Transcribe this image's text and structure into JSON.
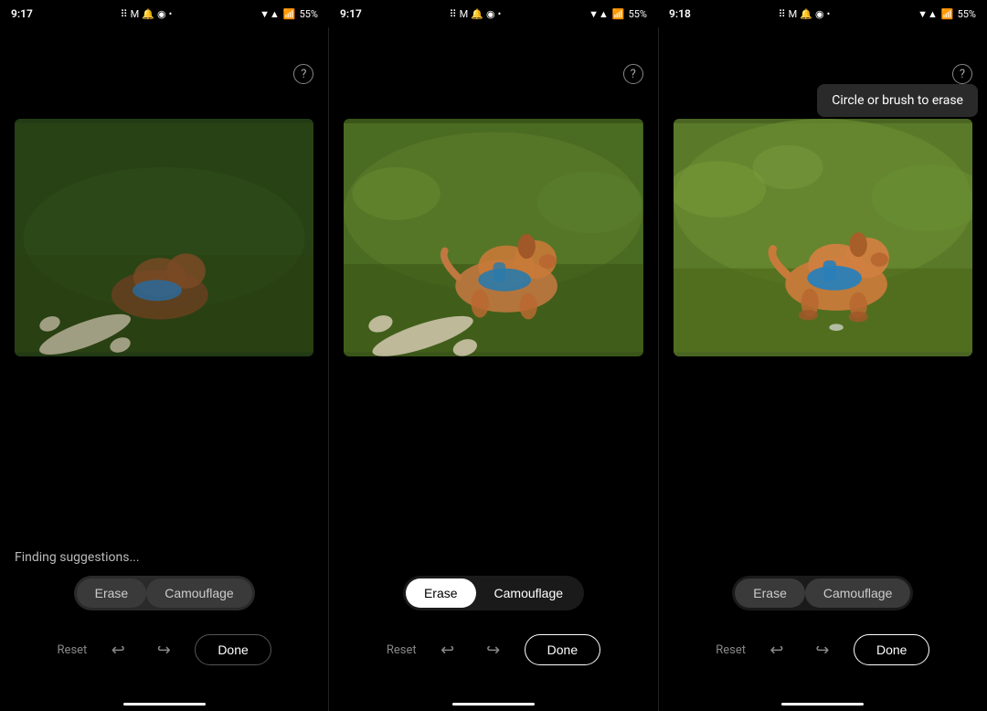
{
  "statusBars": [
    {
      "time": "9:17",
      "battery": "55%",
      "icons": "▼▲ 55%"
    },
    {
      "time": "9:17",
      "battery": "55%"
    },
    {
      "time": "9:18",
      "battery": "55%"
    }
  ],
  "panels": [
    {
      "id": "panel1",
      "showHelp": true,
      "showTooltip": false,
      "findingText": "Finding suggestions...",
      "erase": {
        "eraseLabel": "Erase",
        "eraseActive": false,
        "camouflageLabel": "Camouflage",
        "camouflageActive": false
      },
      "toolbar": {
        "resetLabel": "Reset",
        "doneLabel": "Done",
        "doneActive": false
      }
    },
    {
      "id": "panel2",
      "showHelp": true,
      "showTooltip": false,
      "erase": {
        "eraseLabel": "Erase",
        "eraseActive": true,
        "camouflageLabel": "Camouflage",
        "camouflageActive": false
      },
      "toolbar": {
        "resetLabel": "Reset",
        "doneLabel": "Done",
        "doneActive": true
      }
    },
    {
      "id": "panel3",
      "showHelp": true,
      "showTooltip": true,
      "tooltipText": "Circle or brush to erase",
      "erase": {
        "eraseLabel": "Erase",
        "eraseActive": false,
        "camouflageLabel": "Camouflage",
        "camouflageActive": false
      },
      "toolbar": {
        "resetLabel": "Reset",
        "doneLabel": "Done",
        "doneActive": true
      }
    }
  ],
  "icons": {
    "undo": "↩",
    "redo": "↪",
    "question": "?",
    "wifi": "▼",
    "signal": "▲"
  }
}
